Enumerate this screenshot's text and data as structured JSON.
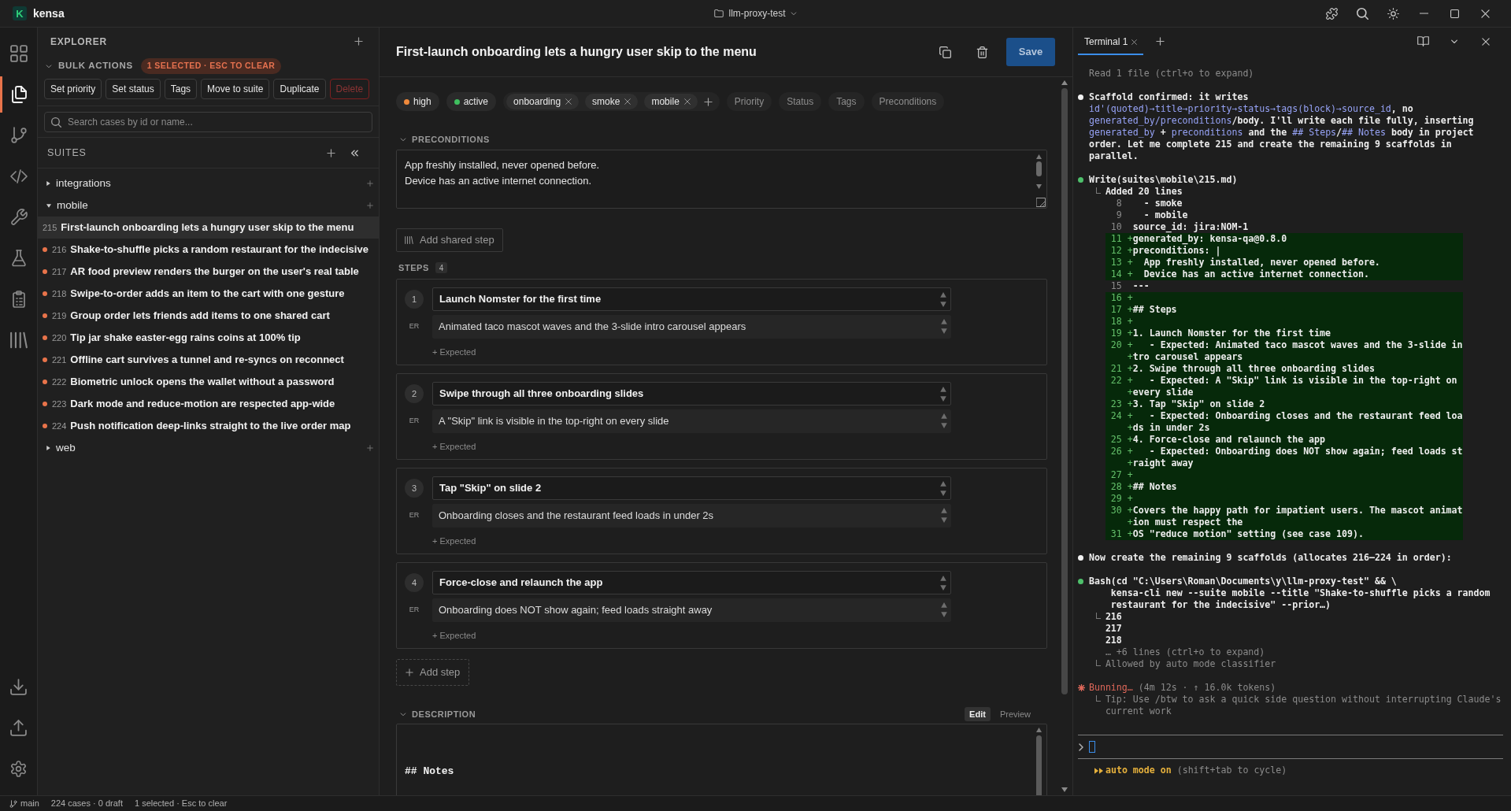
{
  "titlebar": {
    "logo": "K",
    "app_name": "kensa",
    "project": "llm-proxy-test"
  },
  "activity_bar": {
    "items": [
      {
        "selected": false
      },
      {
        "selected": true
      },
      {
        "selected": false
      },
      {
        "selected": false
      },
      {
        "selected": false
      },
      {
        "selected": false
      },
      {
        "selected": false
      },
      {
        "selected": false
      }
    ]
  },
  "sidebar": {
    "title": "EXPLORER",
    "bulk_actions": {
      "label": "BULK ACTIONS",
      "expanded": true,
      "badge": "1 SELECTED · ESC TO CLEAR",
      "buttons": [
        {
          "label": "Set priority",
          "kind": "default"
        },
        {
          "label": "Set status",
          "kind": "default"
        },
        {
          "label": "Tags",
          "kind": "default"
        },
        {
          "label": "Move to suite",
          "kind": "default"
        },
        {
          "label": "Duplicate",
          "kind": "default"
        },
        {
          "label": "Delete",
          "kind": "danger"
        }
      ]
    },
    "search": {
      "placeholder": "Search cases by id or name..."
    },
    "suites": {
      "label": "SUITES",
      "items": [
        {
          "name": "integrations",
          "expanded": false
        },
        {
          "name": "mobile",
          "expanded": true,
          "children": [
            {
              "id": "215",
              "title": "First-launch onboarding lets a hungry user skip to the menu",
              "selected": true
            },
            {
              "id": "216",
              "title": "Shake-to-shuffle picks a random restaurant for the indecisive",
              "selected": false,
              "color": "#e8734a"
            },
            {
              "id": "217",
              "title": "AR food preview renders the burger on the user's real table",
              "selected": false,
              "color": "#e8734a"
            },
            {
              "id": "218",
              "title": "Swipe-to-order adds an item to the cart with one gesture",
              "selected": false,
              "color": "#e8734a"
            },
            {
              "id": "219",
              "title": "Group order lets friends add items to one shared cart",
              "selected": false,
              "color": "#e8734a"
            },
            {
              "id": "220",
              "title": "Tip jar shake easter-egg rains coins at 100% tip",
              "selected": false,
              "color": "#e8734a"
            },
            {
              "id": "221",
              "title": "Offline cart survives a tunnel and re-syncs on reconnect",
              "selected": false,
              "color": "#e8734a"
            },
            {
              "id": "222",
              "title": "Biometric unlock opens the wallet without a password",
              "selected": false,
              "color": "#e8734a"
            },
            {
              "id": "223",
              "title": "Dark mode and reduce-motion are respected app-wide",
              "selected": false,
              "color": "#e8734a"
            },
            {
              "id": "224",
              "title": "Push notification deep-links straight to the live order map",
              "selected": false,
              "color": "#e8734a"
            }
          ]
        },
        {
          "name": "web",
          "expanded": false
        }
      ]
    }
  },
  "editor": {
    "title": "First-launch onboarding lets a hungry user skip to the menu",
    "save": "Save",
    "priority": {
      "label": "high",
      "color": "#f08a3c"
    },
    "status": {
      "label": "active",
      "color": "#3fbf5f"
    },
    "tags": [
      "onboarding",
      "smoke",
      "mobile"
    ],
    "fields": [
      "Priority",
      "Status",
      "Tags",
      "Preconditions"
    ],
    "preconditions": {
      "label": "PRECONDITIONS",
      "expanded": true,
      "value": "App freshly installed, never opened before.\nDevice has an active internet connection."
    },
    "add_shared_step": "Add shared step",
    "steps_label": "STEPS",
    "steps_count": "4",
    "steps": [
      {
        "number": "1",
        "action": "Launch Nomster for the first time",
        "er_label": "ER",
        "expected": "Animated taco mascot waves and the 3-slide intro carousel appears",
        "add_expected": "+ Expected"
      },
      {
        "number": "2",
        "action": "Swipe through all three onboarding slides",
        "er_label": "ER",
        "expected": "A \"Skip\" link is visible in the top-right on every slide",
        "add_expected": "+ Expected"
      },
      {
        "number": "3",
        "action": "Tap \"Skip\" on slide 2",
        "er_label": "ER",
        "expected": "Onboarding closes and the restaurant feed loads in under 2s",
        "add_expected": "+ Expected"
      },
      {
        "number": "4",
        "action": "Force-close and relaunch the app",
        "er_label": "ER",
        "expected": "Onboarding does NOT show again; feed loads straight away",
        "add_expected": "+ Expected"
      }
    ],
    "add_step": "Add step",
    "description": {
      "label": "DESCRIPTION",
      "expanded": true,
      "modes": [
        {
          "label": "Edit",
          "selected": true
        },
        {
          "label": "Preview",
          "selected": false
        }
      ],
      "value": "## Notes"
    }
  },
  "terminal": {
    "tabs": [
      {
        "label": "Terminal 1",
        "selected": true
      }
    ],
    "entries": [
      {
        "kind": "note",
        "text": "Read 1 file (ctrl+o to expand)"
      },
      {
        "kind": "message",
        "lines": [
          [
            {
              "kind": "plain",
              "text": "Scaffold confirmed: it writes"
            }
          ],
          [
            {
              "kind": "code",
              "text": "id'(quoted)→title→priority→status→tags(block)→source_id"
            },
            {
              "kind": "plain",
              "text": ", no"
            }
          ],
          [
            {
              "kind": "code",
              "text": "generated_by/preconditions"
            },
            {
              "kind": "plain",
              "text": "/body. I'll write each file fully, inserting"
            }
          ],
          [
            {
              "kind": "code",
              "text": "generated_by"
            },
            {
              "kind": "plain",
              "text": " + "
            },
            {
              "kind": "code",
              "text": "preconditions"
            },
            {
              "kind": "plain",
              "text": " and the "
            },
            {
              "kind": "code",
              "text": "## Steps"
            },
            {
              "kind": "plain",
              "text": "/"
            },
            {
              "kind": "code",
              "text": "## Notes"
            },
            {
              "kind": "plain",
              "text": " body in project"
            }
          ],
          [
            {
              "kind": "plain",
              "text": "order. Let me complete 215 and create the remaining 9 scaffolds in"
            }
          ],
          [
            {
              "kind": "plain",
              "text": "parallel."
            }
          ]
        ]
      },
      {
        "kind": "tool",
        "title": [
          "Write(suites\\mobile\\215.md)"
        ],
        "output": [
          [
            {
              "kind": "text",
              "text": "Added 20 lines"
            },
            {
              "kind": "diff",
              "rows": [
                {
                  "kind": "context",
                  "num": "8",
                  "text": "  - smoke"
                },
                {
                  "kind": "context",
                  "num": "9",
                  "text": "  - mobile"
                },
                {
                  "kind": "context",
                  "num": "10",
                  "text": "source_id: jira:NOM-1"
                },
                {
                  "kind": "added",
                  "num": "11",
                  "sign": "+",
                  "text": "generated_by: kensa-qa@0.8.0"
                },
                {
                  "kind": "added",
                  "num": "12",
                  "sign": "+",
                  "text": "preconditions: |"
                },
                {
                  "kind": "added",
                  "num": "13",
                  "sign": "+",
                  "text": "  App freshly installed, never opened before."
                },
                {
                  "kind": "added",
                  "num": "14",
                  "sign": "+",
                  "text": "  Device has an active internet connection."
                },
                {
                  "kind": "context",
                  "num": "15",
                  "text": "---"
                },
                {
                  "kind": "added",
                  "num": "16",
                  "sign": "+"
                },
                {
                  "kind": "added",
                  "num": "17",
                  "sign": "+",
                  "text": "## Steps"
                },
                {
                  "kind": "added",
                  "num": "18",
                  "sign": "+"
                },
                {
                  "kind": "added",
                  "num": "19",
                  "sign": "+",
                  "text": "1. Launch Nomster for the first time"
                },
                {
                  "kind": "added",
                  "num": "20",
                  "sign": "+",
                  "text": "   - Expected: Animated taco mascot waves and the 3-slide in"
                },
                {
                  "kind": "added",
                  "sign": "+",
                  "text": "tro carousel appears"
                },
                {
                  "kind": "added",
                  "num": "21",
                  "sign": "+",
                  "text": "2. Swipe through all three onboarding slides"
                },
                {
                  "kind": "added",
                  "num": "22",
                  "sign": "+",
                  "text": "   - Expected: A \"Skip\" link is visible in the top-right on"
                },
                {
                  "kind": "added",
                  "sign": "+",
                  "text": "every slide"
                },
                {
                  "kind": "added",
                  "num": "23",
                  "sign": "+",
                  "text": "3. Tap \"Skip\" on slide 2"
                },
                {
                  "kind": "added",
                  "num": "24",
                  "sign": "+",
                  "text": "   - Expected: Onboarding closes and the restaurant feed loa"
                },
                {
                  "kind": "added",
                  "sign": "+",
                  "text": "ds in under 2s"
                },
                {
                  "kind": "added",
                  "num": "25",
                  "sign": "+",
                  "text": "4. Force-close and relaunch the app"
                },
                {
                  "kind": "added",
                  "num": "26",
                  "sign": "+",
                  "text": "   - Expected: Onboarding does NOT show again; feed loads st"
                },
                {
                  "kind": "added",
                  "sign": "+",
                  "text": "raight away"
                },
                {
                  "kind": "added",
                  "num": "27",
                  "sign": "+"
                },
                {
                  "kind": "added",
                  "num": "28",
                  "sign": "+",
                  "text": "## Notes"
                },
                {
                  "kind": "added",
                  "num": "29",
                  "sign": "+"
                },
                {
                  "kind": "added",
                  "num": "30",
                  "sign": "+",
                  "text": "Covers the happy path for impatient users. The mascot animat"
                },
                {
                  "kind": "added",
                  "sign": "+",
                  "text": "ion must respect the"
                },
                {
                  "kind": "added",
                  "num": "31",
                  "sign": "+",
                  "text": "OS \"reduce motion\" setting (see case 109)."
                }
              ]
            }
          ]
        ]
      },
      {
        "kind": "message",
        "lines": [
          [
            {
              "kind": "plain",
              "text": "Now create the remaining 9 scaffolds (allocates 216–224 in order):"
            }
          ]
        ]
      },
      {
        "kind": "tool",
        "title": [
          "Bash(cd \"C:\\Users\\Roman\\Documents\\y\\llm-proxy-test\" && \\",
          "    kensa-cli new --suite mobile --title \"Shake-to-shuffle picks a random",
          "    restaurant for the indecisive\" --prior…)"
        ],
        "output": [
          [
            {
              "kind": "text",
              "text": "216"
            },
            {
              "kind": "text",
              "text": "217"
            },
            {
              "kind": "text",
              "text": "218"
            },
            {
              "kind": "muted",
              "text": "… +6 lines (ctrl+o to expand)"
            }
          ],
          [
            {
              "kind": "muted",
              "text": "Allowed by auto mode classifier"
            }
          ]
        ]
      },
      {
        "kind": "status",
        "label": "Bunning…",
        "detail": "(4m 12s · ↑ 16.0k tokens)",
        "output": [
          [
            {
              "kind": "muted",
              "text": "Tip: Use /btw to ask a quick side question without interrupting Claude's"
            },
            {
              "kind": "muted",
              "text": "current work"
            }
          ]
        ]
      }
    ],
    "mode": {
      "label": "auto mode on",
      "hint": "(shift+tab to cycle)"
    }
  },
  "status_bar": {
    "branch": "main",
    "items": [
      "224 cases · 0 draft",
      "1 selected · Esc to clear"
    ]
  }
}
